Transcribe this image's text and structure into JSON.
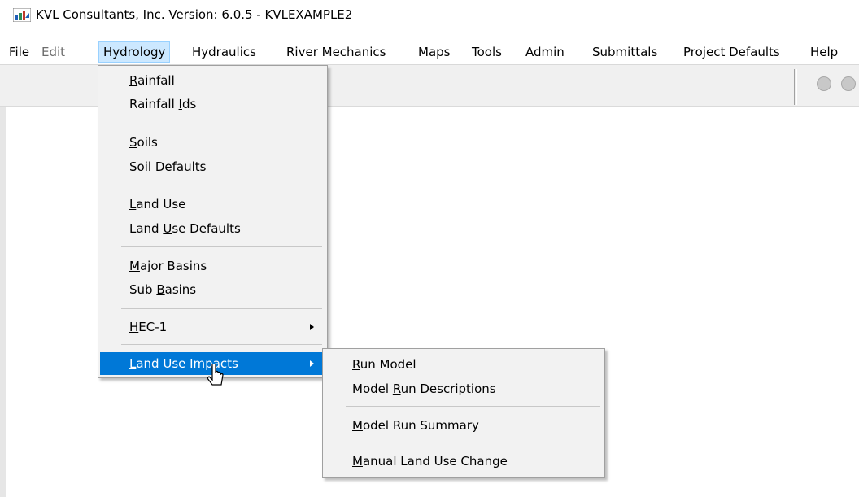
{
  "window": {
    "title": "KVL Consultants, Inc. Version: 6.0.5 - KVLEXAMPLE2"
  },
  "menubar": {
    "items": [
      {
        "label": "File"
      },
      {
        "label": "Edit"
      },
      {
        "label": "Hydrology"
      },
      {
        "label": "Hydraulics"
      },
      {
        "label": "River Mechanics"
      },
      {
        "label": "Maps"
      },
      {
        "label": "Tools"
      },
      {
        "label": "Admin"
      },
      {
        "label": "Submittals"
      },
      {
        "label": "Project Defaults"
      },
      {
        "label": "Help"
      }
    ],
    "active": "Hydrology",
    "disabled": [
      "Edit"
    ]
  },
  "hydrology_menu": {
    "items": [
      {
        "pre": "",
        "ul": "R",
        "post": "ainfall"
      },
      {
        "pre": "Rainfall ",
        "ul": "I",
        "post": "ds"
      },
      {
        "pre": "",
        "ul": "S",
        "post": "oils"
      },
      {
        "pre": "Soil ",
        "ul": "D",
        "post": "efaults"
      },
      {
        "pre": "",
        "ul": "L",
        "post": "and Use"
      },
      {
        "pre": "Land ",
        "ul": "U",
        "post": "se Defaults"
      },
      {
        "pre": "",
        "ul": "M",
        "post": "ajor Basins"
      },
      {
        "pre": "Sub ",
        "ul": "B",
        "post": "asins"
      },
      {
        "pre": "",
        "ul": "H",
        "post": "EC-1"
      },
      {
        "pre": "",
        "ul": "L",
        "post": "and Use Impacts"
      }
    ]
  },
  "land_use_impacts_submenu": {
    "items": [
      {
        "pre": "",
        "ul": "R",
        "post": "un Model"
      },
      {
        "pre": "Model ",
        "ul": "R",
        "post": "un Descriptions"
      },
      {
        "pre": "",
        "ul": "M",
        "post": "odel Run Summary"
      },
      {
        "pre": "",
        "ul": "M",
        "post": "anual Land Use Change"
      }
    ]
  },
  "colors": {
    "menu_highlight": "#0078d7",
    "menubar_active_bg": "#cce8ff",
    "menu_bg": "#f2f2f2",
    "toolbar_bg": "#f0f0f0"
  }
}
